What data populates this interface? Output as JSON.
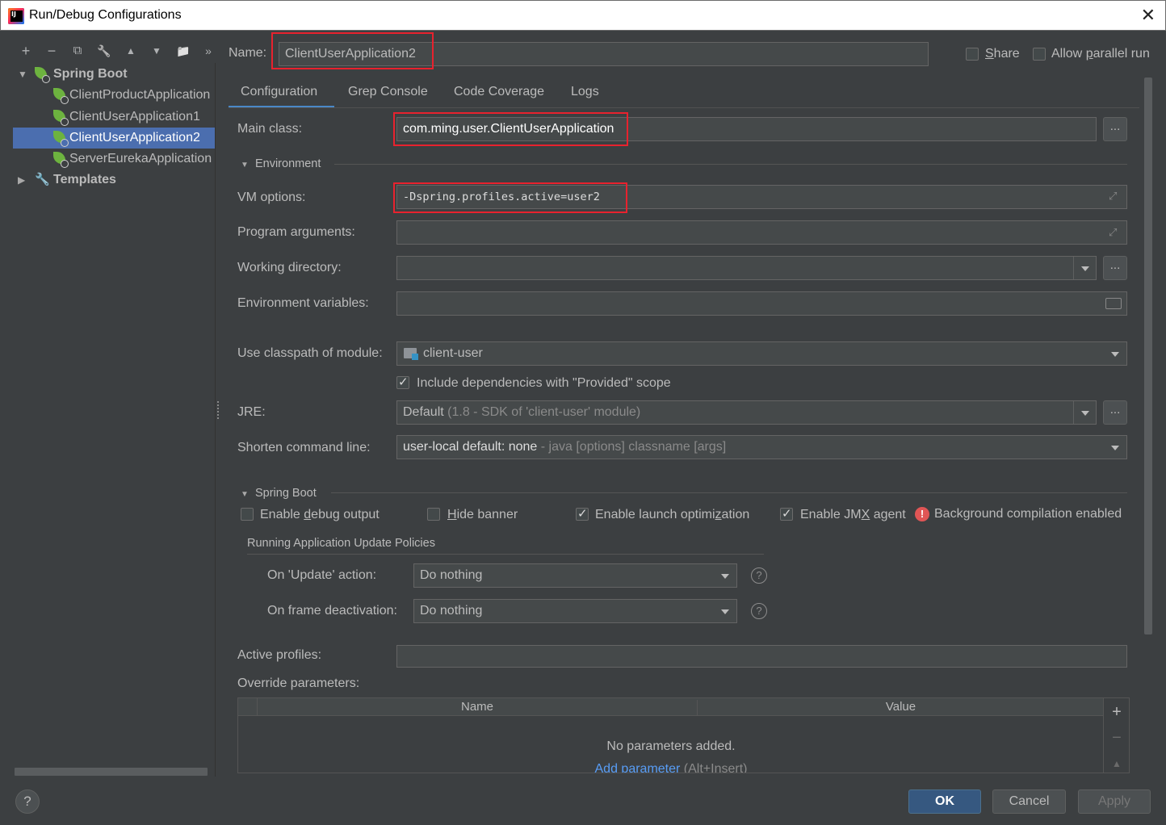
{
  "window": {
    "title": "Run/Debug Configurations",
    "close_glyph": "✕"
  },
  "toolbar": {
    "add": "+",
    "remove": "−",
    "copy": "⧉",
    "edit_defaults": "🔧",
    "move_up": "▲",
    "move_down": "▼",
    "new_folder": "📁",
    "more": "»"
  },
  "tree": {
    "spring_boot": "Spring Boot",
    "items": [
      "ClientProductApplication",
      "ClientUserApplication1",
      "ClientUserApplication2",
      "ServerEurekaApplication"
    ],
    "templates": "Templates"
  },
  "header": {
    "name_label": "Name:",
    "name_value": "ClientUserApplication2",
    "share_label": "Share",
    "share_checked": false,
    "parallel_label": "Allow parallel run",
    "parallel_checked": false
  },
  "tabs": [
    "Configuration",
    "Grep Console",
    "Code Coverage",
    "Logs"
  ],
  "config": {
    "main_class_label": "Main class:",
    "main_class_value": "com.ming.user.ClientUserApplication",
    "environment_section": "Environment",
    "vm_options_label": "VM options:",
    "vm_options_value": "-Dspring.profiles.active=user2",
    "program_args_label": "Program arguments:",
    "program_args_value": "",
    "working_dir_label": "Working directory:",
    "working_dir_value": "",
    "env_vars_label": "Environment variables:",
    "env_vars_value": "",
    "classpath_label": "Use classpath of module:",
    "classpath_value": "client-user",
    "include_deps_label": "Include dependencies with \"Provided\" scope",
    "include_deps_checked": true,
    "jre_label": "JRE:",
    "jre_value": "Default",
    "jre_hint": "(1.8 - SDK of 'client-user' module)",
    "shorten_label": "Shorten command line:",
    "shorten_value": "user-local default: none",
    "shorten_hint": "- java [options] classname [args]",
    "dots": "..."
  },
  "spring_boot": {
    "section": "Spring Boot",
    "debug_output": "Enable debug output",
    "debug_output_checked": false,
    "hide_banner": "Hide banner",
    "hide_banner_checked": false,
    "launch_opt": "Enable launch optimization",
    "launch_opt_checked": true,
    "jmx_agent": "Enable JMX agent",
    "jmx_agent_checked": true,
    "bg_compilation": "Background compilation enabled",
    "warning_glyph": "!",
    "policies_section": "Running Application Update Policies",
    "update_action_label": "On 'Update' action:",
    "update_action_value": "Do nothing",
    "frame_deact_label": "On frame deactivation:",
    "frame_deact_value": "Do nothing",
    "help_glyph": "?"
  },
  "profiles": {
    "active_profiles_label": "Active profiles:",
    "active_profiles_value": "",
    "override_label": "Override parameters:",
    "columns": [
      "Name",
      "Value"
    ],
    "empty_text": "No parameters added.",
    "add_link": "Add parameter",
    "add_shortcut": "(Alt+Insert)",
    "add_glyph": "+",
    "remove_glyph": "−",
    "up_glyph": "▲"
  },
  "footer": {
    "help": "?",
    "ok": "OK",
    "cancel": "Cancel",
    "apply": "Apply"
  },
  "colors": {
    "background": "#3c3f41",
    "selection": "#4b6eaf",
    "highlight_box": "#e8222e",
    "primary_button": "#365880",
    "spring_green": "#6db33f"
  }
}
